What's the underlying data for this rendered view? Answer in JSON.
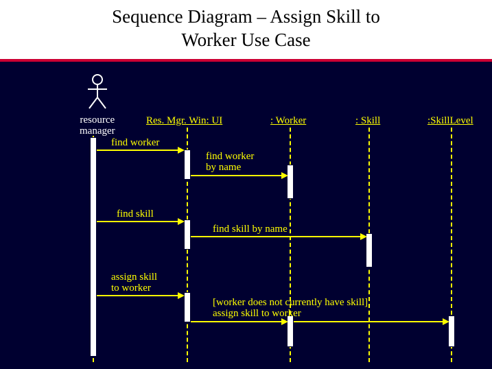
{
  "title_line1": "Sequence Diagram – Assign Skill to",
  "title_line2": "Worker Use Case",
  "actor": {
    "name": "resource",
    "name2": "manager"
  },
  "lifelines": {
    "ui": "Res. Mgr. Win: UI",
    "worker": ": Worker",
    "skill": ": Skill",
    "skilllevel": ":SkillLevel"
  },
  "messages": {
    "m1": "find worker",
    "m2_l1": "find worker",
    "m2_l2": "by name",
    "m3": "find skill",
    "m4": "find skill by name",
    "m5": "assign skill",
    "m5_l2": "to worker",
    "m6_l1": "[worker does not currently have skill]",
    "m6_l2": "assign skill to worker"
  }
}
